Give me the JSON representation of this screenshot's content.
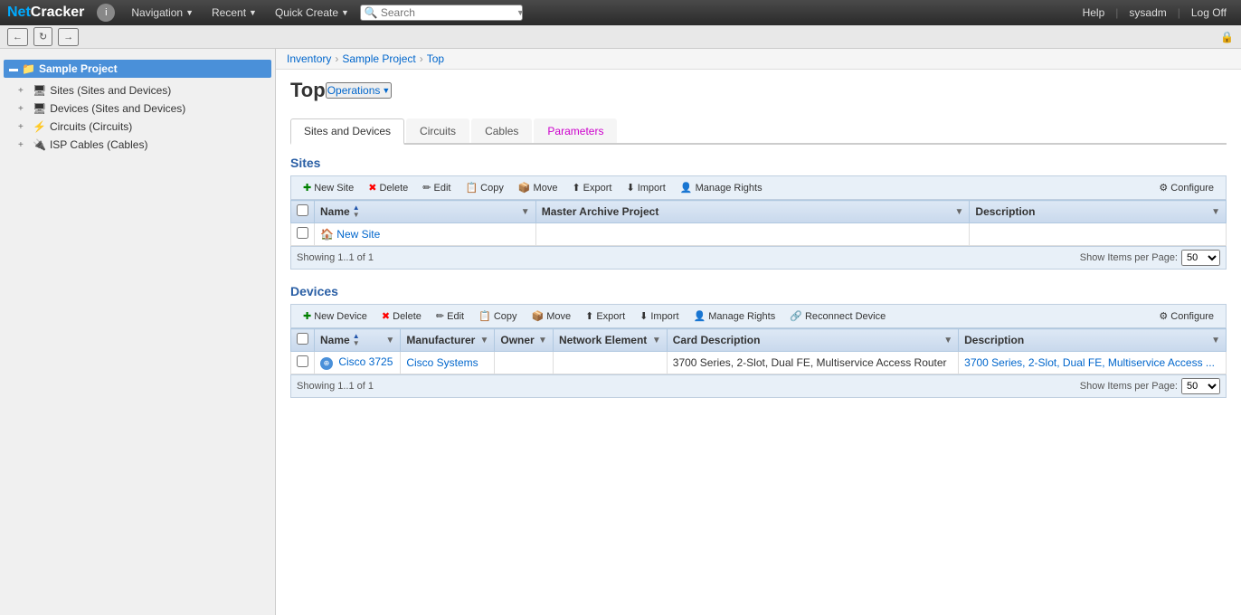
{
  "logo": {
    "brand": "Net",
    "brand2": "Cracker"
  },
  "topbar": {
    "info_label": "i",
    "navigation_label": "Navigation",
    "recent_label": "Recent",
    "quick_create_label": "Quick Create",
    "search_placeholder": "Search",
    "help_label": "Help",
    "user_label": "sysadm",
    "logoff_label": "Log Off"
  },
  "toolbar": {
    "back_label": "←",
    "refresh_label": "↻",
    "forward_label": "→"
  },
  "sidebar": {
    "root_label": "Sample Project",
    "items": [
      {
        "label": "Sites (Sites and Devices)"
      },
      {
        "label": "Devices (Sites and Devices)"
      },
      {
        "label": "Circuits (Circuits)"
      },
      {
        "label": "ISP Cables (Cables)"
      }
    ]
  },
  "breadcrumb": {
    "inventory": "Inventory",
    "project": "Sample Project",
    "top": "Top"
  },
  "page": {
    "title": "Top",
    "operations_label": "Operations"
  },
  "tabs": [
    {
      "label": "Sites and Devices",
      "active": true,
      "highlighted": false
    },
    {
      "label": "Circuits",
      "active": false,
      "highlighted": false
    },
    {
      "label": "Cables",
      "active": false,
      "highlighted": false
    },
    {
      "label": "Parameters",
      "active": false,
      "highlighted": true
    }
  ],
  "sites_section": {
    "title": "Sites",
    "toolbar": {
      "new_label": "New Site",
      "delete_label": "Delete",
      "edit_label": "Edit",
      "copy_label": "Copy",
      "move_label": "Move",
      "export_label": "Export",
      "import_label": "Import",
      "manage_rights_label": "Manage Rights",
      "configure_label": "Configure"
    },
    "columns": [
      {
        "label": "Name"
      },
      {
        "label": "Master Archive Project"
      },
      {
        "label": "Description"
      }
    ],
    "rows": [
      {
        "name": "New Site",
        "master_archive": "",
        "description": ""
      }
    ],
    "showing": "Showing 1..1 of 1",
    "show_per_page_label": "Show Items per Page:",
    "per_page_value": "50"
  },
  "devices_section": {
    "title": "Devices",
    "toolbar": {
      "new_label": "New Device",
      "delete_label": "Delete",
      "edit_label": "Edit",
      "copy_label": "Copy",
      "move_label": "Move",
      "export_label": "Export",
      "import_label": "Import",
      "manage_rights_label": "Manage Rights",
      "reconnect_label": "Reconnect Device",
      "configure_label": "Configure"
    },
    "columns": [
      {
        "label": "Name"
      },
      {
        "label": "Manufacturer"
      },
      {
        "label": "Owner"
      },
      {
        "label": "Network Element"
      },
      {
        "label": "Card Description"
      },
      {
        "label": "Description"
      }
    ],
    "rows": [
      {
        "name": "Cisco 3725",
        "manufacturer": "Cisco Systems",
        "owner": "",
        "network_element": "",
        "card_description": "3700 Series, 2-Slot, Dual FE, Multiservice Access Router",
        "description": "3700 Series, 2-Slot, Dual FE, Multiservice Access ..."
      }
    ],
    "showing": "Showing 1..1 of 1",
    "show_per_page_label": "Show Items per Page:",
    "per_page_value": "50"
  }
}
